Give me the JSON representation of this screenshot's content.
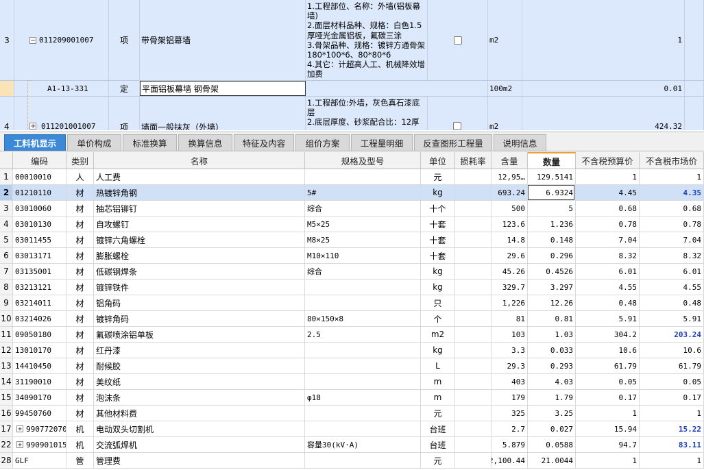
{
  "top_rows": [
    {
      "rownum": "3",
      "expander": "−",
      "code": "011209001007",
      "unit_type": "项",
      "name": "带骨架铝幕墙",
      "desc": "1.工程部位、名称：外墙(铝板幕墙)\n2.面层材料品种、规格：白色1.5厚哑光金属铝板，氟碳三涂\n3.骨架品种、规格：镀锌方通骨架180*100*6、80*80*6\n4.其它：计超高人工、机械降效增加费",
      "unit": "m2",
      "qty": "1"
    },
    {
      "rownum": "",
      "code": "A1-13-331",
      "unit_type": "定",
      "name": "平面铝板幕墙 钢骨架",
      "desc": "",
      "unit": "100m2",
      "qty": "0.01"
    },
    {
      "rownum": "4",
      "expander": "+",
      "code": "011201001007",
      "unit_type": "项",
      "name": "墙面一般抹灰（外墙）",
      "desc": "1.工程部位:外墙，灰色真石漆底层\n2.底层厚度、砂浆配合比：12厚",
      "unit": "m2",
      "qty": "424.32"
    }
  ],
  "tabs": [
    "工料机显示",
    "单价构成",
    "标准换算",
    "换算信息",
    "特征及内容",
    "组价方案",
    "工程量明细",
    "反查图形工程量",
    "说明信息"
  ],
  "columns": [
    "",
    "编码",
    "类别",
    "名称",
    "规格及型号",
    "单位",
    "损耗率",
    "含量",
    "数量",
    "不含税预算价",
    "不含税市场价"
  ],
  "rows": [
    {
      "n": "1",
      "code": "00010010",
      "cat": "人",
      "name": "人工费",
      "spec": "",
      "unit": "元",
      "loss": "",
      "content": "12,95…",
      "qty": "129.5141",
      "budget": "1",
      "market": "1",
      "hl": false
    },
    {
      "n": "2",
      "code": "01210110",
      "cat": "材",
      "name": "热镀锌角钢",
      "spec": "5#",
      "unit": "kg",
      "loss": "",
      "content": "693.24",
      "qty": "6.9324",
      "budget": "4.45",
      "market": "4.35",
      "hl": true
    },
    {
      "n": "3",
      "code": "03010060",
      "cat": "材",
      "name": "抽芯铝铆钉",
      "spec": "综合",
      "unit": "十个",
      "loss": "",
      "content": "500",
      "qty": "5",
      "budget": "0.68",
      "market": "0.68",
      "hl": false
    },
    {
      "n": "4",
      "code": "03010130",
      "cat": "材",
      "name": "自攻螺钉",
      "spec": "M5×25",
      "unit": "十套",
      "loss": "",
      "content": "123.6",
      "qty": "1.236",
      "budget": "0.78",
      "market": "0.78",
      "hl": false
    },
    {
      "n": "5",
      "code": "03011455",
      "cat": "材",
      "name": "镀锌六角螺栓",
      "spec": "M8×25",
      "unit": "十套",
      "loss": "",
      "content": "14.8",
      "qty": "0.148",
      "budget": "7.04",
      "market": "7.04",
      "hl": false
    },
    {
      "n": "6",
      "code": "03013171",
      "cat": "材",
      "name": "膨胀螺栓",
      "spec": "M10×110",
      "unit": "十套",
      "loss": "",
      "content": "29.6",
      "qty": "0.296",
      "budget": "8.32",
      "market": "8.32",
      "hl": false
    },
    {
      "n": "7",
      "code": "03135001",
      "cat": "材",
      "name": "低碳钢焊条",
      "spec": "综合",
      "unit": "kg",
      "loss": "",
      "content": "45.26",
      "qty": "0.4526",
      "budget": "6.01",
      "market": "6.01",
      "hl": false
    },
    {
      "n": "8",
      "code": "03213121",
      "cat": "材",
      "name": "镀锌铁件",
      "spec": "",
      "unit": "kg",
      "loss": "",
      "content": "329.7",
      "qty": "3.297",
      "budget": "4.55",
      "market": "4.55",
      "hl": false
    },
    {
      "n": "9",
      "code": "03214011",
      "cat": "材",
      "name": "铝角码",
      "spec": "",
      "unit": "只",
      "loss": "",
      "content": "1,226",
      "qty": "12.26",
      "budget": "0.48",
      "market": "0.48",
      "hl": false
    },
    {
      "n": "10",
      "code": "03214026",
      "cat": "材",
      "name": "镀锌角码",
      "spec": "80×150×8",
      "unit": "个",
      "loss": "",
      "content": "81",
      "qty": "0.81",
      "budget": "5.91",
      "market": "5.91",
      "hl": false
    },
    {
      "n": "11",
      "code": "09050180",
      "cat": "材",
      "name": "氟碳喷涂铝单板",
      "spec": "2.5",
      "unit": "m2",
      "loss": "",
      "content": "103",
      "qty": "1.03",
      "budget": "304.2",
      "market": "203.24",
      "hl": true
    },
    {
      "n": "12",
      "code": "13010170",
      "cat": "材",
      "name": "红丹漆",
      "spec": "",
      "unit": "kg",
      "loss": "",
      "content": "3.3",
      "qty": "0.033",
      "budget": "10.6",
      "market": "10.6",
      "hl": false
    },
    {
      "n": "13",
      "code": "14410450",
      "cat": "材",
      "name": "耐候胶",
      "spec": "",
      "unit": "L",
      "loss": "",
      "content": "29.3",
      "qty": "0.293",
      "budget": "61.79",
      "market": "61.79",
      "hl": false
    },
    {
      "n": "14",
      "code": "31190010",
      "cat": "材",
      "name": "美纹纸",
      "spec": "",
      "unit": "m",
      "loss": "",
      "content": "403",
      "qty": "4.03",
      "budget": "0.05",
      "market": "0.05",
      "hl": false
    },
    {
      "n": "15",
      "code": "34090170",
      "cat": "材",
      "name": "泡沫条",
      "spec": "φ18",
      "unit": "m",
      "loss": "",
      "content": "179",
      "qty": "1.79",
      "budget": "0.17",
      "market": "0.17",
      "hl": false
    },
    {
      "n": "16",
      "code": "99450760",
      "cat": "材",
      "name": "其他材料费",
      "spec": "",
      "unit": "元",
      "loss": "",
      "content": "325",
      "qty": "3.25",
      "budget": "1",
      "market": "1",
      "hl": false
    },
    {
      "n": "17",
      "code": "990772070",
      "cat": "机",
      "name": "电动双头切割机",
      "spec": "",
      "unit": "台班",
      "loss": "",
      "content": "2.7",
      "qty": "0.027",
      "budget": "15.94",
      "market": "15.22",
      "hl": true,
      "exp": "+"
    },
    {
      "n": "22",
      "code": "990901015",
      "cat": "机",
      "name": "交流弧焊机",
      "spec": "容量30(kV·A)",
      "unit": "台班",
      "loss": "",
      "content": "5.879",
      "qty": "0.0588",
      "budget": "94.7",
      "market": "83.11",
      "hl": true,
      "exp": "+"
    },
    {
      "n": "28",
      "code": "GLF",
      "cat": "管",
      "name": "管理费",
      "spec": "",
      "unit": "元",
      "loss": "",
      "content": "2,100.44",
      "qty": "21.0044",
      "budget": "1",
      "market": "1",
      "hl": false
    }
  ]
}
